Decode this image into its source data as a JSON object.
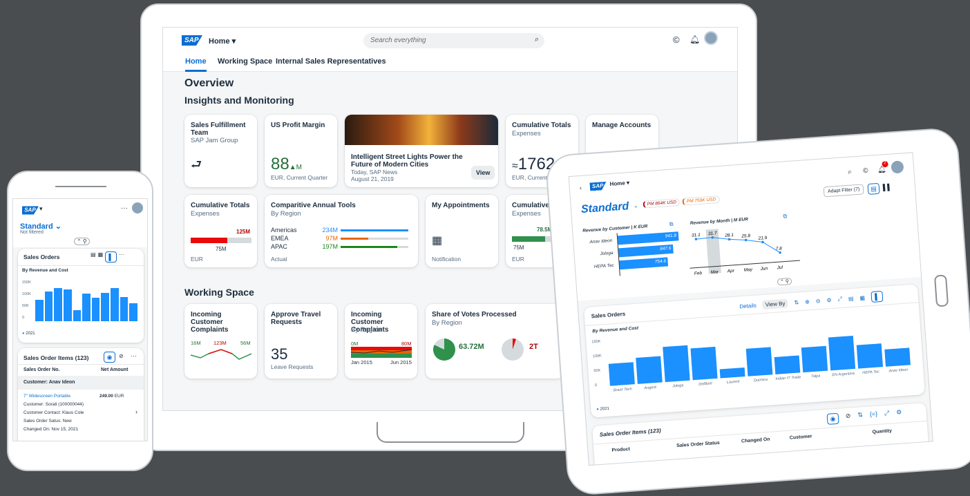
{
  "laptop": {
    "shell": {
      "logo": "SAP",
      "home": "Home ▾",
      "search": "Search everything"
    },
    "tabs": [
      "Home",
      "Working Space",
      "Internal Sales Representatives"
    ],
    "overview": "Overview",
    "section1": "Insights and Monitoring",
    "section2": "Working Space",
    "cards": {
      "sft": {
        "title": "Sales Fulfillment Team",
        "sub": "SAP Jam Group"
      },
      "upm": {
        "title": "US Profit Margin",
        "value": "88",
        "unit": "M",
        "foot": "EUR, Current Quarter"
      },
      "news": {
        "title": "Intelligent Street Lights Power the Future of Modern Cities",
        "src": "Today, SAP News",
        "date": "August 21, 2019",
        "btn": "View"
      },
      "ct1": {
        "title": "Cumulative Totals",
        "sub": "Expenses",
        "value": "1762",
        "foot": "EUR, Current Quarter"
      },
      "ma": {
        "title": "Manage Accounts"
      },
      "ct2": {
        "title": "Cumulative Totals",
        "sub": "Expenses",
        "target": "125M",
        "actual": "75M",
        "foot": "EUR",
        "fill": 0.6
      },
      "cat": {
        "title": "Comparitive Annual Tools",
        "sub": "By Region",
        "rows": [
          {
            "label": "Americas",
            "val": "234M",
            "pct": 1.0,
            "color": "#1b90ff"
          },
          {
            "label": "EMEA",
            "val": "97M",
            "pct": 0.41,
            "color": "#e76500"
          },
          {
            "label": "APAC",
            "val": "197M",
            "pct": 0.84,
            "color": "#188918"
          }
        ],
        "foot": "Actual"
      },
      "appt": {
        "title": "My Appointments",
        "foot": "Notification"
      },
      "ct3": {
        "title": "Cumulative Totals",
        "sub": "Expenses",
        "target": "78.5M",
        "actual": "75M",
        "foot": "EUR"
      },
      "icc1": {
        "title": "Incoming Customer Complaints",
        "v1": "16M",
        "v2": "123M",
        "v3": "56M"
      },
      "atr": {
        "title": "Approve Travel Requests",
        "value": "35",
        "foot": "Leave Requests"
      },
      "icc2": {
        "title": "Incoming Customer Complaints",
        "sub": "By Region",
        "l1": "0M",
        "l2": "80M",
        "d1": "Jan 2015",
        "d2": "Jun 2015"
      },
      "svp": {
        "title": "Share of Votes Processed",
        "sub": "By Region",
        "v1": "63.72M",
        "v2": "2T"
      }
    }
  },
  "phone": {
    "logo": "SAP",
    "variant": "Standard ⌄",
    "filter": "Not filtered",
    "so": "Sales Orders",
    "by": "By Revenue and Cost",
    "yticks": [
      "150K",
      "100K",
      "50K",
      "0"
    ],
    "legend": "2021",
    "bars": [
      0.55,
      0.75,
      0.85,
      0.8,
      0.28,
      0.7,
      0.6,
      0.72,
      0.85,
      0.62,
      0.45
    ],
    "soi": "Sales Order Items (123)",
    "col1": "Sales Order No.",
    "col2": "Net Amount",
    "group": "Customer: Anav Ideon",
    "item": {
      "name": "7\" Widescreen Portable",
      "amt": "249.00",
      "cur": "EUR",
      "cust": "Customer: Sorali (100000044)",
      "contact": "Customer Contact: Klaus Cole",
      "status": "Sales Order Satus: New",
      "changed": "Changed On: Nov 15, 2021"
    }
  },
  "tablet": {
    "logo": "SAP",
    "home": "Home ▾",
    "variant": "Standard",
    "tags": [
      {
        "t": "PM 864K USD",
        "c": "#aa0808"
      },
      {
        "t": "PM 759K USD",
        "c": "#e76500"
      }
    ],
    "adapt": "Adapt Filter (7)",
    "notif": "2",
    "rbc": {
      "title": "Revenue by Customer | K EUR",
      "rows": [
        {
          "label": "Anav Ideon",
          "val": "941.8",
          "pct": 1.0
        },
        {
          "label": "Jologa",
          "val": "847.6",
          "pct": 0.9
        },
        {
          "label": "HEPA Tec",
          "val": "754.6",
          "pct": 0.8
        }
      ]
    },
    "rbm": {
      "title": "Revenue by Month | M EUR",
      "months": [
        "Feb",
        "Mar",
        "Apr",
        "May",
        "Jun",
        "Jul"
      ],
      "vals": [
        31.1,
        31.7,
        28.1,
        25.8,
        21.9,
        7.8
      ]
    },
    "so": {
      "title": "Sales Orders",
      "details": "Details",
      "viewby": "View By",
      "by": "By Revenue and Cost",
      "yticks": [
        "150K",
        "100K",
        "50K",
        "0"
      ],
      "legend": "2021",
      "cats": [
        "Brazil Tech",
        "Angeré",
        "Jologa",
        "DelBont",
        "Laurent",
        "Quimica",
        "Indian IT Trade",
        "Talpa",
        "EN Argentina",
        "HEPA Tec",
        "Anav Ideon"
      ],
      "vals": [
        0.48,
        0.58,
        0.78,
        0.7,
        0.2,
        0.6,
        0.38,
        0.55,
        0.72,
        0.52,
        0.38
      ]
    },
    "soi": {
      "title": "Sales Order Items (123)",
      "cols": [
        "Product",
        "Sales Order Status",
        "Changed On",
        "Customer",
        "Quantity"
      ]
    }
  }
}
